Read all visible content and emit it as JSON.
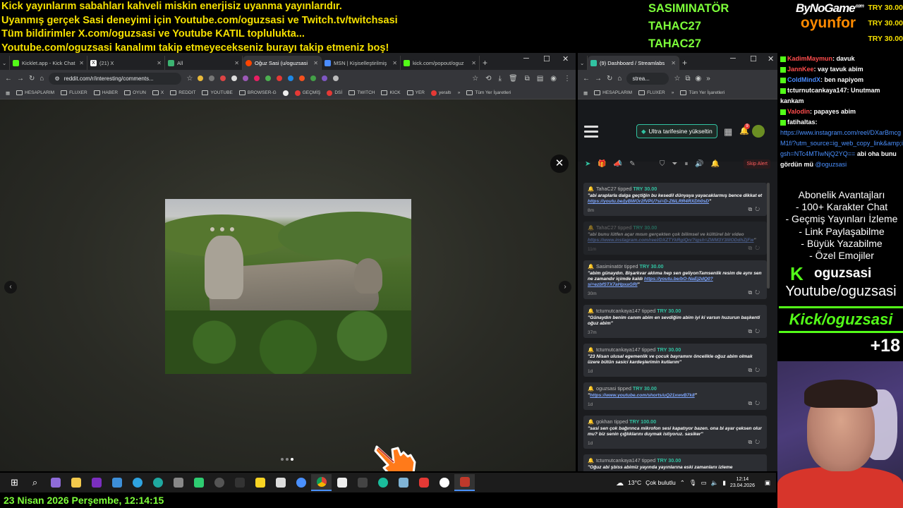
{
  "overlay": {
    "ticker": [
      "Kick yayınlarım sabahları kahveli miskin enerjisiz uyanma yayınlarıdır.",
      "Uyanmış gerçek Sasi deneyimi için Youtube.com/oguzsasi ve Twitch.tv/twitchsasi",
      "Tüm bildirimler X.com/oguzsasi ve Youtube KATIL toplulukta...",
      "Youtube.com/oguzsasi kanalımı takip etmeyecekseniz burayı takip etmeniz boş!"
    ],
    "tippers": [
      "SASIMINATÖR",
      "TAHAC27",
      "TAHAC27"
    ],
    "brand_top": "ByNoGame",
    "brand_dot": ".com",
    "brand_bottom": "oyunfor",
    "tip_values": [
      "TRY 30.00",
      "TRY 30.00",
      "TRY 30.00"
    ]
  },
  "browser1": {
    "tabs": [
      {
        "label": "Kicklet.app - Kick Chat",
        "color": "#53fc18"
      },
      {
        "label": "(21) X",
        "color": "#ffffff"
      },
      {
        "label": "All",
        "color": "#3cb371"
      },
      {
        "label": "Oğuz Sasi (u/oguzsasi",
        "color": "#ff4500"
      },
      {
        "label": "MSN | Kişiselleştirilmiş",
        "color": "#4a8cff"
      },
      {
        "label": "kick.com/popout/oguz",
        "color": "#53fc18"
      }
    ],
    "new_tab": "+",
    "url": "reddit.com/r/interesting/comments...",
    "bookmarks": [
      "HESAPLARIM",
      "FLUXER",
      "HABER",
      "OYUN",
      "X",
      "REDDIT",
      "YOUTUBE",
      "BROWSER-G",
      "GEÇMİŞ",
      "DSİ",
      "TWITCH",
      "KICK",
      "YER",
      "yeraltı",
      "Tüm Yer İşaretleri"
    ],
    "close_glyph": "✕",
    "prev_glyph": "‹",
    "next_glyph": "›"
  },
  "browser2": {
    "tab_label": "(9) Dashboard / Streamlabs",
    "url": "strea...",
    "bookmarks": [
      "HESAPLARIM",
      "FLUXER",
      "Tüm Yer İşaretleri"
    ],
    "upgrade_label": "Ultra tarifesine yükseltin",
    "notif_count": "9",
    "skip_label": "Skip Alert",
    "tips": [
      {
        "user": "TahaC27",
        "verb": "tipped",
        "amount": "TRY 30.00",
        "msg": "\"abi araplarla dalga geçtiğin bu kesedil dünyaya yayacaklarmış bence dikkat et ",
        "link": "https://youtu.be/jyBWOr2fVPU?si=D-Z6iLRR4RXDh0sD",
        "end": "\"",
        "time": "8m",
        "dim": false
      },
      {
        "user": "TahaC27",
        "verb": "tipped",
        "amount": "TRY 30.00",
        "msg": "\"abi bunu lütfen açar mısın gerçekten çok bilimsel ve kültürel bir video ",
        "link": "https://www.instagram.com/reel/DXZTYkRglQn/?igsh=ZWM3Y3lIlODdhZjFw",
        "end": "\"",
        "time": "11m",
        "dim": true
      },
      {
        "user": "Sasiminatör",
        "verb": "tipped",
        "amount": "TRY 30.00",
        "msg": "\"abim günaydın. Bişarkvar aklıma hep sen geliyonTamsenlik resim de aynı sen ne zamandır içimde kaldı ",
        "link": "https://youtu.be/bO-NaEj2dQ0?si=ezbfSTX7aHpxaGRl",
        "end": "\"",
        "time": "30m",
        "dim": false
      },
      {
        "user": "tcturnutcankaya147",
        "verb": "tipped",
        "amount": "TRY 30.00",
        "msg": "\"Günaydın benim canım abim en sevdiğim abim iyi ki varsın huzurun başkenti oğuz abim\"",
        "link": "",
        "end": "",
        "time": "37m",
        "dim": false
      },
      {
        "user": "tcturnutcankaya147",
        "verb": "tipped",
        "amount": "TRY 30.00",
        "msg": "\"23 Nisan ulusal egemenlik ve çocuk bayramını öncelikle oğuz abim olmak üzere bütün sasici kardeşlerimin kutlarım\"",
        "link": "",
        "end": "",
        "time": "1d",
        "dim": false
      },
      {
        "user": "oguzsasi",
        "verb": "tipped",
        "amount": "TRY 30.00",
        "msg": "\"",
        "link": "https://www.youtube.com/shorts/uQ21xwvB7k8",
        "end": "\"",
        "time": "1d",
        "dim": false
      },
      {
        "user": "gokhan",
        "verb": "tipped",
        "amount": "TRY 100.00",
        "msg": "\"sasi sen çok bağırınca mikrofon sesi kapatıyor bazen. ona bi ayar çeksen olur mu? biz senin çığlıklarını duymak istiyoruz. sasiker\"",
        "link": "",
        "end": "",
        "time": "1d",
        "dim": false
      },
      {
        "user": "tcturnutcankaya147",
        "verb": "tipped",
        "amount": "TRY 30.00",
        "msg": "\"Oğuz abi şbiss abimiz yayında yayınlarına eski zamanlarıı izleme",
        "link": "",
        "end": "",
        "time": "",
        "dim": false
      }
    ]
  },
  "chat": [
    {
      "user": "KadimMaymun",
      "text": "davuk",
      "color": "#ff4d4d"
    },
    {
      "user": "JannKee",
      "text": "vay tavuk abim",
      "color": "#ff4d4d"
    },
    {
      "user": "ColdMindX",
      "text": "ben napiyom",
      "color": "#4a8cff"
    },
    {
      "user": "tcturnutcankaya147",
      "text": "Unutmam kankam",
      "color": "#ffffff"
    },
    {
      "user": "Valodin",
      "text": "papayes abim",
      "color": "#ff4d4d"
    },
    {
      "user": "fatihaltas",
      "text": "",
      "color": "#ffffff",
      "link": "https://www.instagram.com/reel/DXarBmcgM1f/?utm_source=ig_web_copy_link&amp;igsh=NTc4MTIwNjQ2YQ==",
      "after": "abi oha bunu gördün mü ",
      "mention": "@oguzsasi"
    }
  ],
  "perks": [
    "Abonelik Avantajları",
    "- 100+ Karakter Chat",
    "- Geçmiş Yayınları İzleme",
    "- Link Paylaşabilme",
    "- Büyük Yazabilme",
    "- Özel Emojiler"
  ],
  "socials": {
    "kick_logo": "K",
    "kick_handle": "oguzsasi",
    "youtube": "Youtube/oguzsasi",
    "kick": "Kick/oguzsasi",
    "age": "+18"
  },
  "taskbar": {
    "weather_temp": "13°C",
    "weather_desc": "Çok bulutlu",
    "time": "12:14",
    "date": "23.04.2026"
  },
  "date_strip": "23 Nisan 2026 Perşembe, 12:14:15"
}
